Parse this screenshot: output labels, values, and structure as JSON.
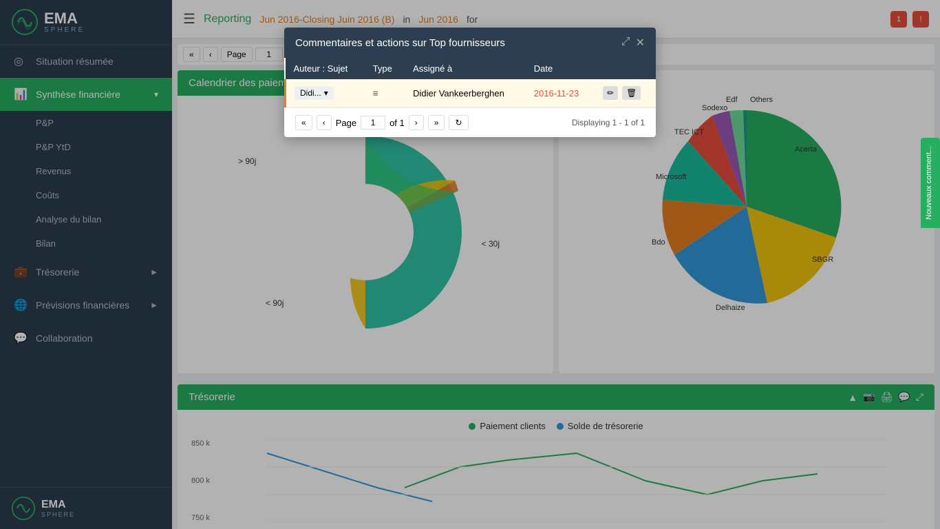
{
  "app": {
    "name": "EMA",
    "sub": "SPHERE"
  },
  "topbar": {
    "menu_icon": "☰",
    "reporting": "Reporting",
    "period": "Jun 2016-Closing Juin 2016 (B)",
    "in": "in",
    "date": "Jun 2016",
    "for": "for"
  },
  "sidebar": {
    "items": [
      {
        "id": "situation",
        "label": "Situation résumée",
        "icon": "◎",
        "active": false
      },
      {
        "id": "synthese",
        "label": "Synthèse financière",
        "icon": "📊",
        "active": true,
        "arrow": "▾"
      },
      {
        "id": "pp",
        "label": "P&P",
        "sub": true
      },
      {
        "id": "ppytd",
        "label": "P&P YtD",
        "sub": true
      },
      {
        "id": "revenus",
        "label": "Revenus",
        "sub": true
      },
      {
        "id": "couts",
        "label": "Coûts",
        "sub": true
      },
      {
        "id": "analyse",
        "label": "Analyse du bilan",
        "sub": true
      },
      {
        "id": "bilan",
        "label": "Bilan",
        "sub": true
      },
      {
        "id": "tresorerie",
        "label": "Trésorerie",
        "icon": "💼",
        "arrow": "►"
      },
      {
        "id": "previsions",
        "label": "Prévisions financières",
        "icon": "🌐",
        "arrow": "►"
      },
      {
        "id": "collaboration",
        "label": "Collaboration",
        "icon": "💬"
      }
    ]
  },
  "panels": {
    "calendrier": {
      "title": "Calendrier des paiements clients",
      "labels": {
        "gt90": "> 90j",
        "lt30": "< 30j",
        "lt90": "< 90j"
      }
    },
    "tresorerie": {
      "title": "Trésorerie",
      "legend": [
        {
          "label": "Paiement clients",
          "color": "#27ae60"
        },
        {
          "label": "Solde de trésorerie",
          "color": "#3498db"
        }
      ],
      "y_labels": [
        "850 k",
        "800 k",
        "750 k"
      ]
    }
  },
  "modal": {
    "title": "Commentaires et actions sur Top fournisseurs",
    "table": {
      "headers": [
        "Auteur : Sujet",
        "Type",
        "Assigné à",
        "Date"
      ],
      "rows": [
        {
          "author": "Didi...",
          "type_icon": "≡",
          "assigned": "Didier Vankeerberghen",
          "date": "2016-11-23",
          "date_red": true
        }
      ]
    },
    "pagination": {
      "page_label": "Page",
      "page_value": "1",
      "of": "of 1",
      "displaying": "Displaying 1 - 1 of 1"
    }
  },
  "vertical_tab": {
    "label": "Nouveaux comment..."
  },
  "pie_labels": {
    "acerta": "Acerta",
    "sbgr": "SBGR",
    "delhaize": "Delhaize",
    "bdo": "Bdo",
    "microsoft": "Microsoft",
    "tec_ict": "TEC ICT",
    "sodexo": "Sodexo",
    "edf": "Edf",
    "others": "Others"
  }
}
